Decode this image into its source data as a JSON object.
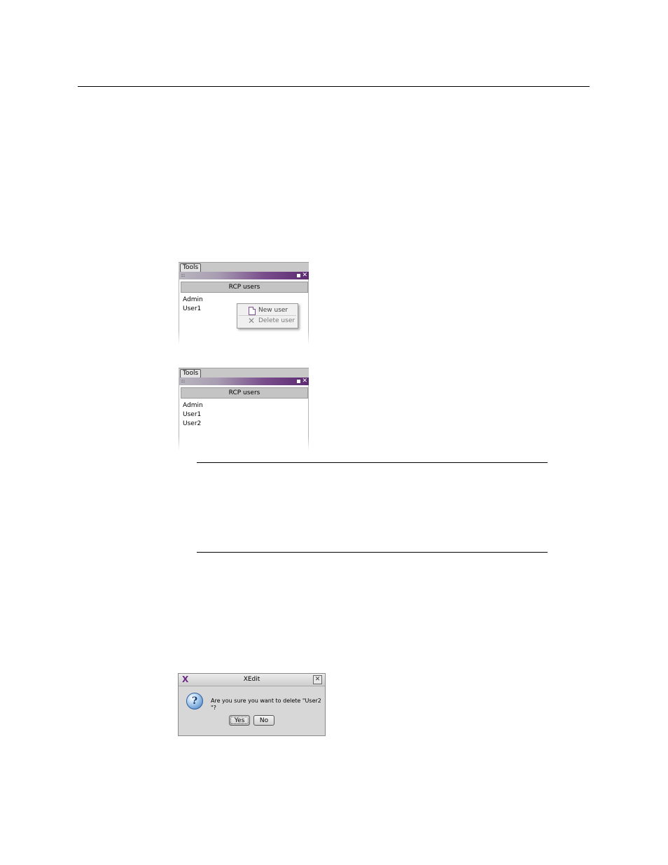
{
  "panel1": {
    "menu_label": "Tools",
    "header": "RCP users",
    "users": [
      "Admin",
      "User1"
    ],
    "context_menu": {
      "items": [
        {
          "label": "New user",
          "icon": "new-document-icon",
          "enabled": true
        },
        {
          "label": "Delete user",
          "icon": "delete-x-icon",
          "enabled": false
        }
      ]
    }
  },
  "panel2": {
    "menu_label": "Tools",
    "header": "RCP users",
    "users": [
      "Admin",
      "User1",
      "User2"
    ]
  },
  "dialog": {
    "title": "XEdit",
    "message": "Are you sure you want to delete \"User2 \"?",
    "yes_label": "Yes",
    "no_label": "No",
    "close_glyph": "✕",
    "icon": "question-icon"
  },
  "colors": {
    "titlebar_accent": "#5c2a72",
    "dialog_bg": "#d7d7d7"
  }
}
